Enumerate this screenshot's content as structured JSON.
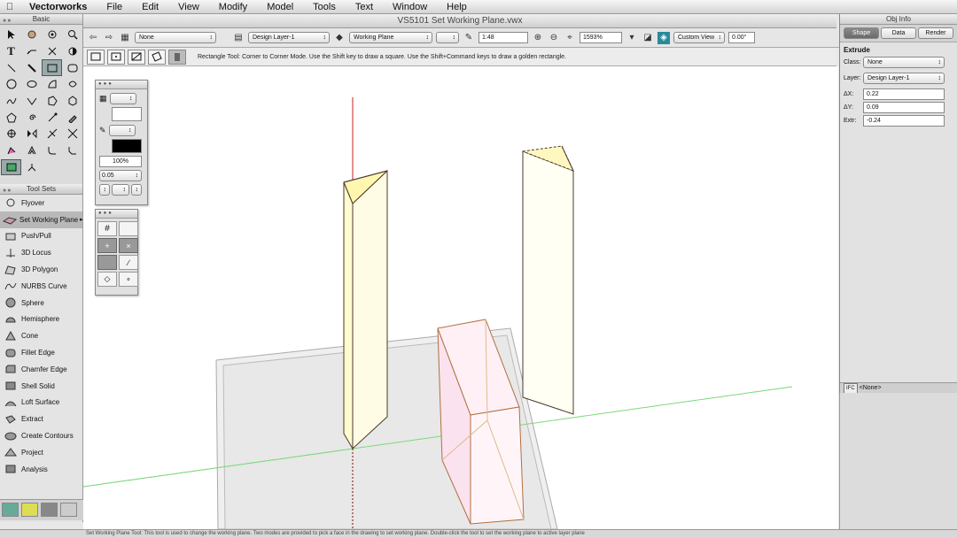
{
  "menubar": {
    "items": [
      "Vectorworks",
      "File",
      "Edit",
      "View",
      "Modify",
      "Model",
      "Tools",
      "Text",
      "Window",
      "Help"
    ]
  },
  "basic_palette": {
    "title": "Basic"
  },
  "toolsets": {
    "title": "Tool Sets",
    "items": [
      "Flyover",
      "Set Working Plane",
      "Push/Pull",
      "3D Locus",
      "3D Polygon",
      "NURBS Curve",
      "Sphere",
      "Hemisphere",
      "Cone",
      "Fillet Edge",
      "Chamfer Edge",
      "Shell Solid",
      "Loft Surface",
      "Extract",
      "Create Contours",
      "Project",
      "Analysis"
    ]
  },
  "document": {
    "title": "VS5101 Set Working Plane.vwx"
  },
  "viewbar": {
    "class_value": "None",
    "layer_value": "Design Layer-1",
    "plane_value": "Working Plane",
    "scale_value": "1:48",
    "zoom_value": "1593%",
    "view_value": "Custom View",
    "angle_value": "0.00°"
  },
  "modebar": {
    "hint": "Rectangle Tool: Corner to Corner Mode. Use the Shift key to draw a square. Use the Shift+Command keys to draw a golden rectangle."
  },
  "attributes": {
    "opacity": "100%",
    "line_weight": "0.05"
  },
  "obj_info": {
    "title": "Obj Info",
    "tabs": [
      "Shape",
      "Data",
      "Render"
    ],
    "object_type": "Extrude",
    "class_label": "Class:",
    "class_value": "None",
    "layer_label": "Layer:",
    "layer_value": "Design Layer-1",
    "dx_label": "ΔX:",
    "dx_value": "0.22",
    "dy_label": "ΔY:",
    "dy_value": "0.09",
    "extr_label": "Extr:",
    "extr_value": "-0.24",
    "footer_value": "<None>"
  },
  "status": {
    "text": "Set Working Plane Tool: This tool is used to change the working plane. Two modes are provided to pick a face in the drawing to set working plane. Double-click the tool to set the working plane to active layer plane"
  },
  "colors": {
    "prism_fill": "#fffbd0",
    "prism_edge": "#4a3a2a",
    "box_fill": "#fbe2ef",
    "box_edge": "#b07040",
    "axis_red": "#c42020",
    "axis_green": "#7cd87c"
  }
}
